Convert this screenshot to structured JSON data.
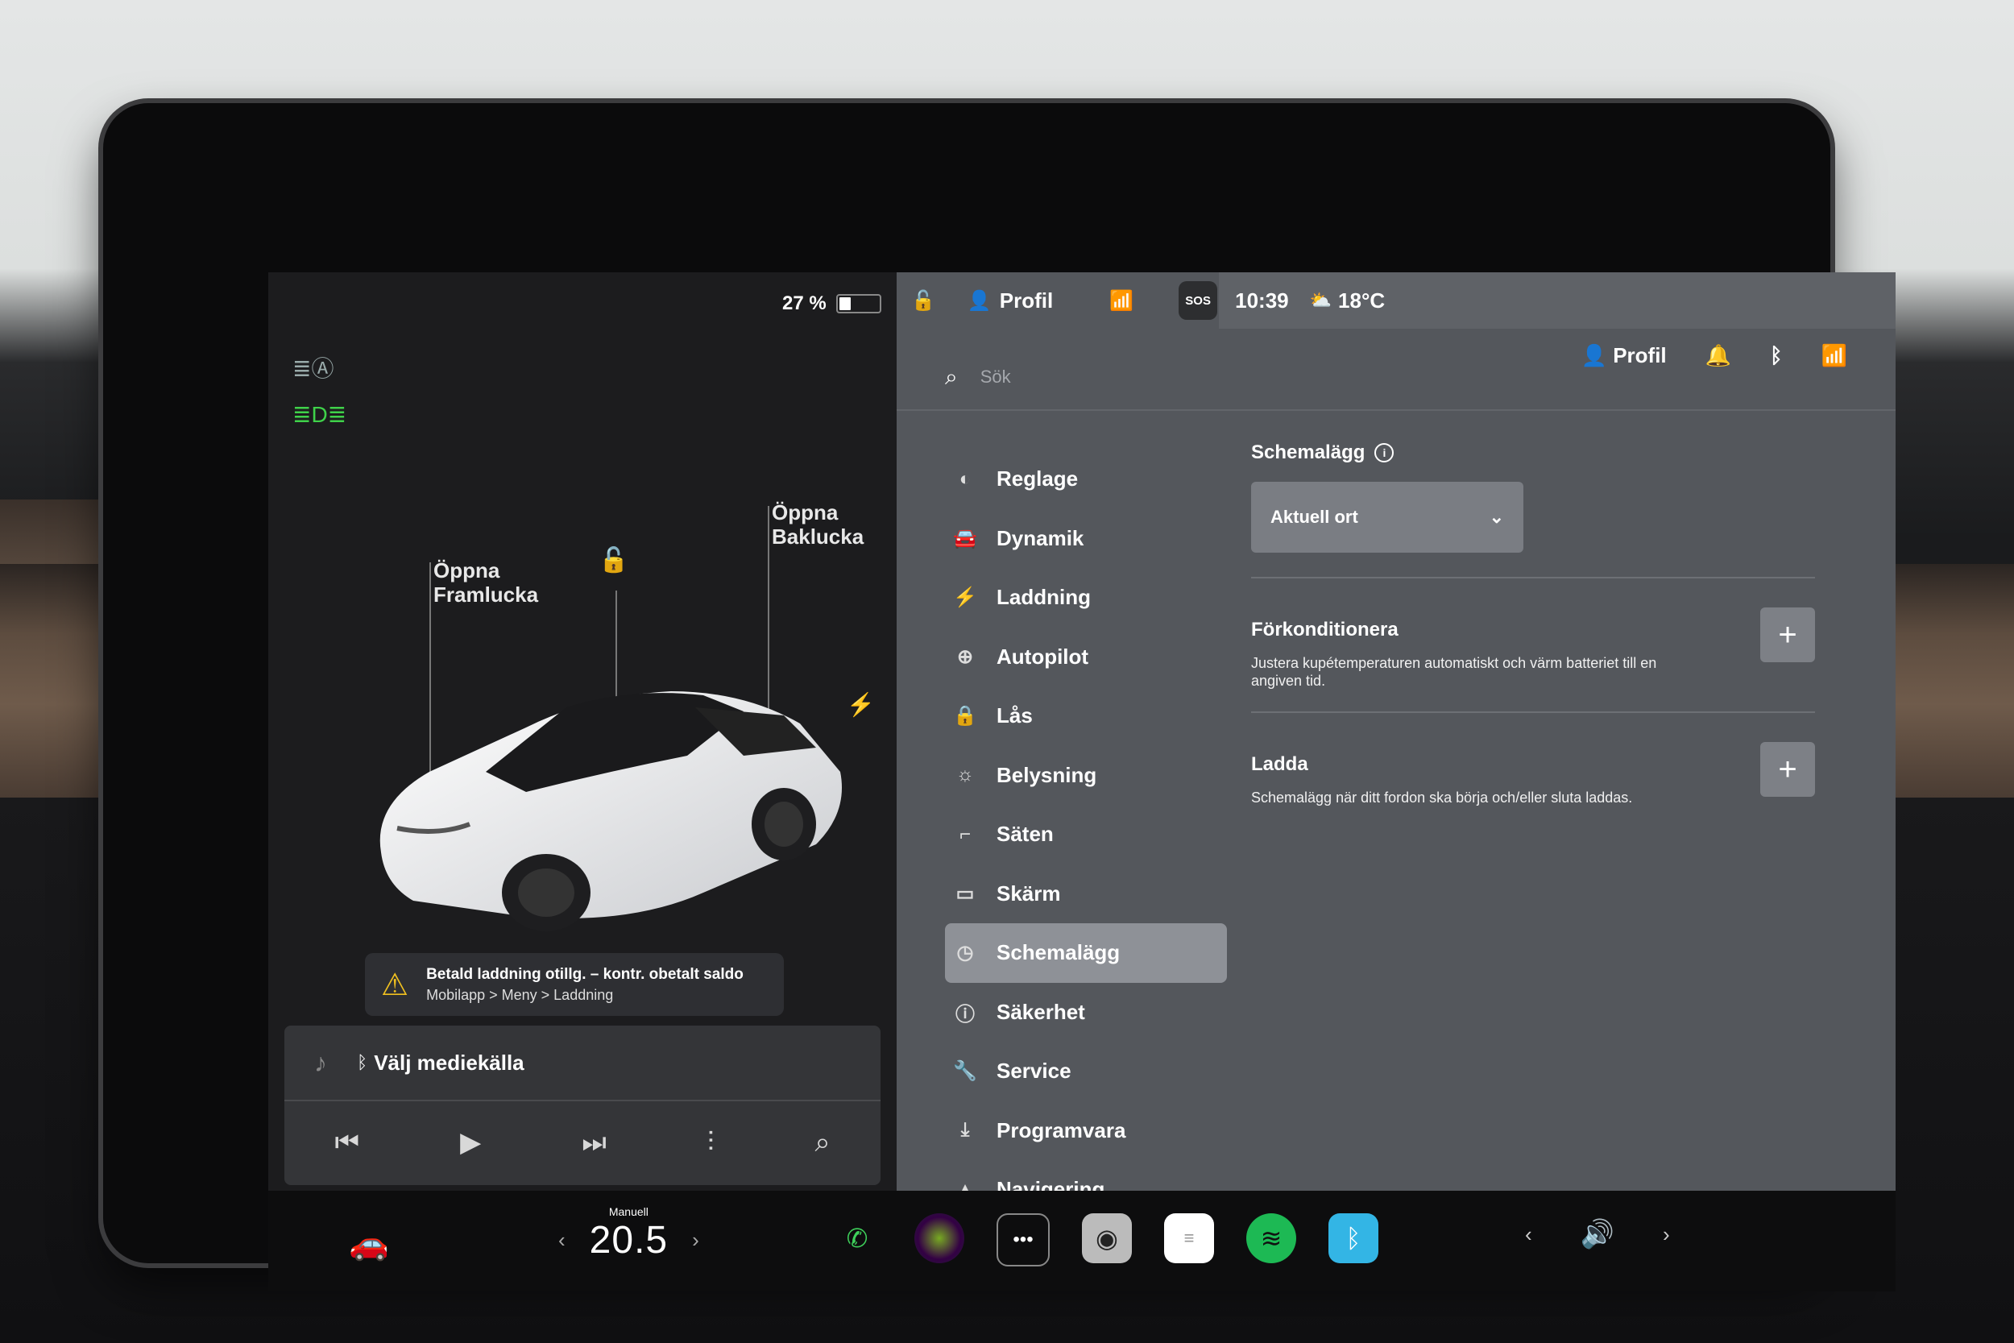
{
  "status": {
    "battery": "27 %",
    "battery_level": 0.27,
    "profile": "Profil",
    "sos": "SOS",
    "time": "10:39",
    "temperature": "18°C"
  },
  "car": {
    "frunk_label": "Öppna\nFramlucka",
    "trunk_label": "Öppna\nBaklucka",
    "warning_line1": "Betald laddning otillg. – kontr. obetalt saldo",
    "warning_line2": "Mobilapp > Meny > Laddning"
  },
  "media": {
    "source": "Välj mediekälla"
  },
  "search": {
    "placeholder": "Sök"
  },
  "header": {
    "profile": "Profil"
  },
  "menu": [
    {
      "label": "Reglage",
      "icon": "toggle-icon"
    },
    {
      "label": "Dynamik",
      "icon": "car-icon"
    },
    {
      "label": "Laddning",
      "icon": "bolt-icon"
    },
    {
      "label": "Autopilot",
      "icon": "steering-wheel-icon"
    },
    {
      "label": "Lås",
      "icon": "lock-icon"
    },
    {
      "label": "Belysning",
      "icon": "light-icon"
    },
    {
      "label": "Säten",
      "icon": "seat-icon"
    },
    {
      "label": "Skärm",
      "icon": "display-icon"
    },
    {
      "label": "Schemalägg",
      "icon": "clock-icon",
      "active": true
    },
    {
      "label": "Säkerhet",
      "icon": "info-icon"
    },
    {
      "label": "Service",
      "icon": "wrench-icon"
    },
    {
      "label": "Programvara",
      "icon": "download-icon"
    },
    {
      "label": "Navigering",
      "icon": "navigation-icon"
    }
  ],
  "schedule": {
    "title": "Schemalägg",
    "dropdown_value": "Aktuell ort",
    "precondition_title": "Förkonditionera",
    "precondition_desc": "Justera kupétemperaturen automatiskt och värm batteriet till en angiven tid.",
    "charge_title": "Ladda",
    "charge_desc": "Schemalägg när ditt fordon ska börja och/eller sluta laddas."
  },
  "bottom": {
    "climate_mode": "Manuell",
    "temperature": "20.5"
  },
  "colors": {
    "active_item": "#8e9197",
    "panel": "#54575c",
    "spotify": "#1db954",
    "bluetooth": "#33b5e5",
    "phone": "#3ecf5a"
  }
}
